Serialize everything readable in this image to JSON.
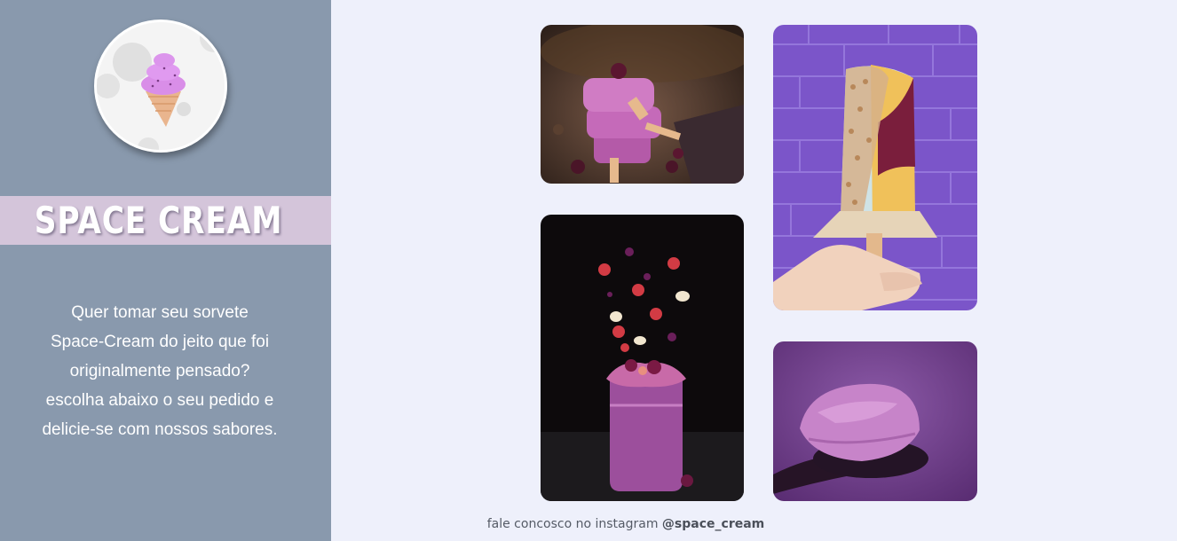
{
  "brand": {
    "name": "SPACE CREAM",
    "logo_icon": "ice-cream-cone-icon"
  },
  "sidebar": {
    "tagline_lines": [
      "Quer tomar seu sorvete",
      "Space-Cream do jeito que foi",
      "originalmente pensado?",
      "escolha abaixo o seu pedido e",
      "delicie-se com nossos sabores."
    ]
  },
  "gallery": {
    "photos": [
      "stacked-berry-popsicles",
      "popsicle-held-against-purple-brick-wall",
      "berry-smoothie-jar-with-flying-fruit",
      "purple-ice-cream-scoop-on-spoon"
    ]
  },
  "footer": {
    "text": "fale concosco no instagram",
    "handle": "@space_cream"
  },
  "colors": {
    "sidebar": "#8999ad",
    "brand_band": "#d4c5da",
    "page_background": "#eef0fb",
    "accent_purple": "#d98ee8"
  }
}
